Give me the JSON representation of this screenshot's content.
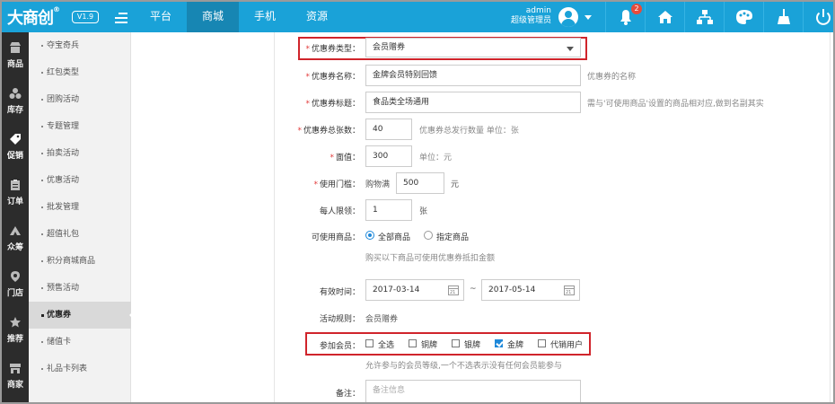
{
  "brand": {
    "logo_text": "大商创",
    "version": "V1.9"
  },
  "top_nav": {
    "items": [
      "平台",
      "商城",
      "手机",
      "资源"
    ],
    "active": "商城"
  },
  "user": {
    "name": "admin",
    "role": "超级管理员"
  },
  "notifications": {
    "count": "2"
  },
  "colors": {
    "topbar": "#1aa2d8",
    "topbar_active": "#1786b3",
    "sidebar": "#2c2c2c",
    "highlight": "#d0242b",
    "checkbox_on": "#1e88d9"
  },
  "sidebar": {
    "items": [
      "商品",
      "库存",
      "促销",
      "订单",
      "众筹",
      "门店",
      "推荐",
      "商家"
    ],
    "active": "促销"
  },
  "submenu": {
    "items": [
      "夺宝奇兵",
      "红包类型",
      "团购活动",
      "专题管理",
      "拍卖活动",
      "优惠活动",
      "批发管理",
      "超值礼包",
      "积分商城商品",
      "预售活动",
      "优惠券",
      "储值卡",
      "礼品卡列表"
    ],
    "active": "优惠券"
  },
  "form": {
    "coupon_type": {
      "label": "优惠券类型：",
      "value": "会员赠券"
    },
    "coupon_name": {
      "label": "优惠券名称：",
      "value": "金牌会员特别回馈",
      "hint": "优惠券的名称"
    },
    "coupon_title": {
      "label": "优惠券标题：",
      "value": "食品类全场通用",
      "hint": "需与'可使用商品'设置的商品相对应,做到名副其实"
    },
    "total_count": {
      "label": "优惠券总张数：",
      "value": "40",
      "hint": "优惠券总发行数量 单位：张"
    },
    "face_value": {
      "label": "面值：",
      "value": "300",
      "hint": "单位：元"
    },
    "threshold": {
      "label": "使用门槛：",
      "prefix": "购物满",
      "value": "500",
      "unit": "元"
    },
    "per_limit": {
      "label": "每人限领：",
      "value": "1",
      "unit": "张"
    },
    "goods_scope": {
      "label": "可使用商品：",
      "options": [
        "全部商品",
        "指定商品"
      ],
      "selected": "全部商品",
      "hint": "购买以下商品可使用优惠券抵扣金额"
    },
    "valid_time": {
      "label": "有效时间：",
      "start": "2017-03-14",
      "end": "2017-05-14",
      "separator": "~"
    },
    "activity_rule": {
      "label": "活动规则：",
      "value": "会员赠券"
    },
    "member_levels": {
      "label": "参加会员：",
      "options": [
        "全选",
        "铜牌",
        "银牌",
        "金牌",
        "代销用户"
      ],
      "checked": [
        "金牌"
      ],
      "hint": "允许参与的会员等级,一个不选表示没有任何会员能参与"
    },
    "remark": {
      "label": "备注：",
      "placeholder": "备注信息"
    }
  }
}
